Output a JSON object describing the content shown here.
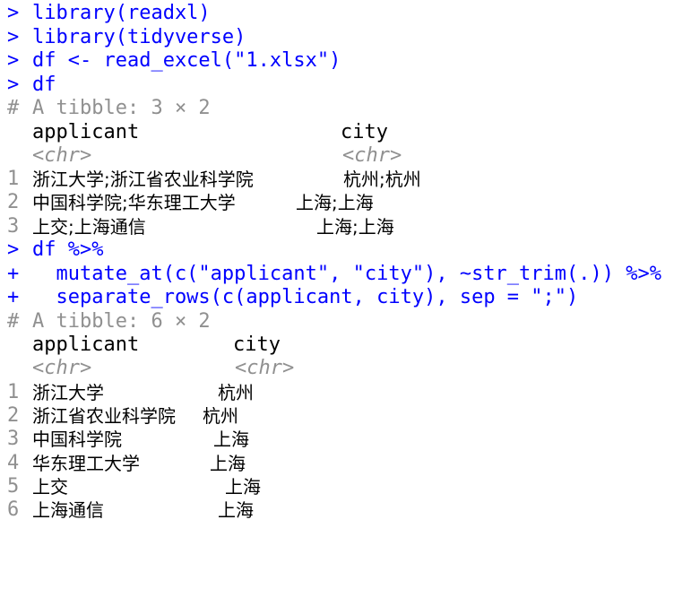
{
  "console": {
    "prompt_symbol": ">",
    "continuation_symbol": "+",
    "comment_symbol": "#",
    "commands": {
      "cmd1": "library(readxl)",
      "cmd2": "library(tidyverse)",
      "cmd3": "df <- read_excel(\"1.xlsx\")",
      "cmd4": "df",
      "cmd5": "df %>%",
      "cmd6": "  mutate_at(c(\"applicant\", \"city\"), ~str_trim(.)) %>%",
      "cmd7": "  separate_rows(c(applicant, city), sep = \";\")"
    },
    "table1": {
      "header": "A tibble: 3 × 2",
      "columns": [
        "applicant",
        "city"
      ],
      "types": [
        "<chr>",
        "<chr>"
      ],
      "rows": [
        {
          "num": "1",
          "applicant": "浙江大学;浙江省农业科学院",
          "city": "杭州;杭州"
        },
        {
          "num": "2",
          "applicant": "中国科学院;华东理工大学",
          "city": "上海;上海"
        },
        {
          "num": "3",
          "applicant": "上交;上海通信",
          "city": "上海;上海"
        }
      ]
    },
    "table2": {
      "header": "A tibble: 6 × 2",
      "columns": [
        "applicant",
        "city"
      ],
      "types": [
        "<chr>",
        "<chr>"
      ],
      "rows": [
        {
          "num": "1",
          "applicant": "浙江大学",
          "city": "杭州"
        },
        {
          "num": "2",
          "applicant": "浙江省农业科学院",
          "city": "杭州"
        },
        {
          "num": "3",
          "applicant": "中国科学院",
          "city": "上海"
        },
        {
          "num": "4",
          "applicant": "华东理工大学",
          "city": "上海"
        },
        {
          "num": "5",
          "applicant": "上交",
          "city": "上海"
        },
        {
          "num": "6",
          "applicant": "上海通信",
          "city": "上海"
        }
      ]
    }
  },
  "colors": {
    "command": "#0000ff",
    "output": "#000000",
    "dim": "#909090",
    "background": "#ffffff"
  }
}
